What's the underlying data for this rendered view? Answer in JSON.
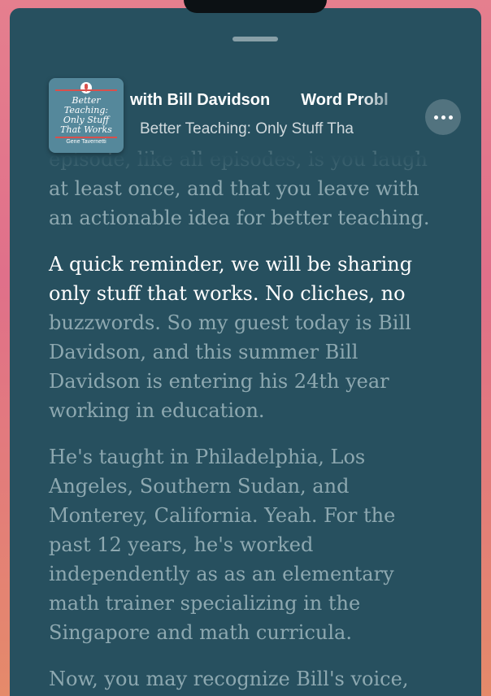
{
  "header": {
    "episode_title": "with Bill Davidson",
    "episode_title_next": "Word Probl",
    "show_name": "Better Teaching: Only Stuff Tha",
    "more_button": "more-options"
  },
  "artwork": {
    "title_line_1": "Better",
    "title_line_2": "Teaching:",
    "title_line_3": "Only Stuff",
    "title_line_4": "That Works",
    "author": "Gene Tavernetti"
  },
  "transcript": {
    "cut_line": "episode, like all episodes, is you laugh",
    "para1_line1": "at least once, and that you leave with",
    "para1_line2": "an actionable idea for better teaching.",
    "para2_active_line1": "A quick reminder, we will be sharing",
    "para2_active_line2": "only stuff that works. No cliches, no",
    "para2_line3": "buzzwords. So my guest today is Bill",
    "para2_line4": "Davidson, and this summer Bill",
    "para2_line5": "Davidson is entering his 24th year",
    "para2_line6": "working in education.",
    "para3_line1": "He's taught in Philadelphia, Los",
    "para3_line2": "Angeles, Southern Sudan, and",
    "para3_line3": "Monterey, California. Yeah. For the",
    "para3_line4": "past 12 years, he's worked",
    "para3_line5": "independently as as an elementary",
    "para3_line6": "math trainer specializing in the",
    "para3_line7": "Singapore and math curricula.",
    "para4_line1": "Now, you may recognize Bill's voice,"
  },
  "colors": {
    "background_gradient": "#e57f8e",
    "sheet": "#27505f",
    "active_text": "#ffffff",
    "inactive_text": "#cddee2",
    "artwork": "#55889b",
    "artwork_accent": "#d8504c"
  }
}
